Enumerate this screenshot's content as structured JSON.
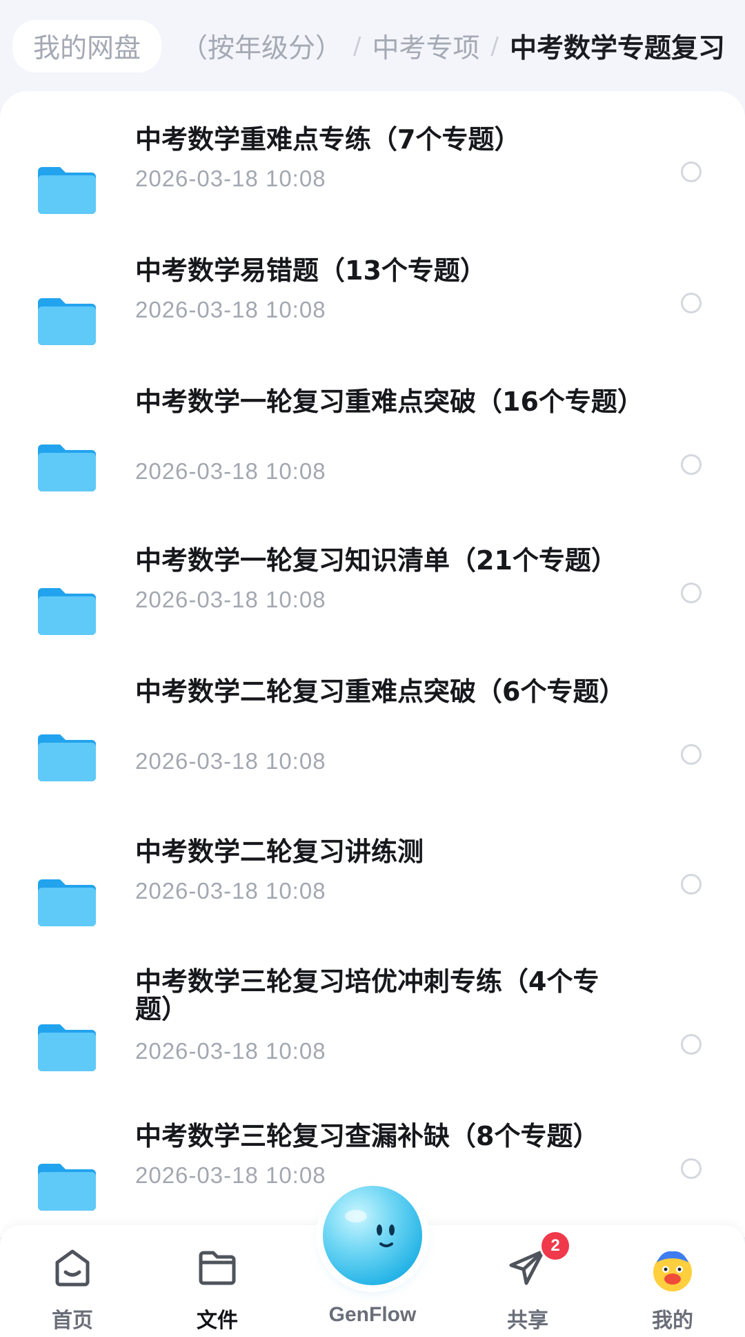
{
  "breadcrumb": {
    "root": "我的网盘",
    "level1": "（按年级分）",
    "separator": "/",
    "level2": "中考专项",
    "current": "中考数学专题复习"
  },
  "folders": [
    {
      "title": "中考数学重难点专练（7个专题）",
      "time": "2026-03-18  10:08"
    },
    {
      "title": "中考数学易错题（13个专题）",
      "time": "2026-03-18  10:08"
    },
    {
      "title": "中考数学一轮复习重难点突破（16个专题）",
      "time": "2026-03-18  10:08"
    },
    {
      "title": "中考数学一轮复习知识清单（21个专题）",
      "time": "2026-03-18  10:08"
    },
    {
      "title": "中考数学二轮复习重难点突破（6个专题）",
      "time": "2026-03-18  10:08"
    },
    {
      "title": "中考数学二轮复习讲练测",
      "time": "2026-03-18  10:08"
    },
    {
      "title": "中考数学三轮复习培优冲刺专练（4个专题）",
      "time": "2026-03-18  10:08"
    },
    {
      "title": "中考数学三轮复习查漏补缺（8个专题）",
      "time": "2026-03-18  10:08"
    }
  ],
  "nav": {
    "home": "首页",
    "files": "文件",
    "genflow": "GenFlow",
    "share": "共享",
    "share_badge": "2",
    "mine": "我的"
  },
  "colors": {
    "folder": "#3bb8f5",
    "badge": "#f0394a",
    "genflow_orb": "#26b4e6"
  }
}
